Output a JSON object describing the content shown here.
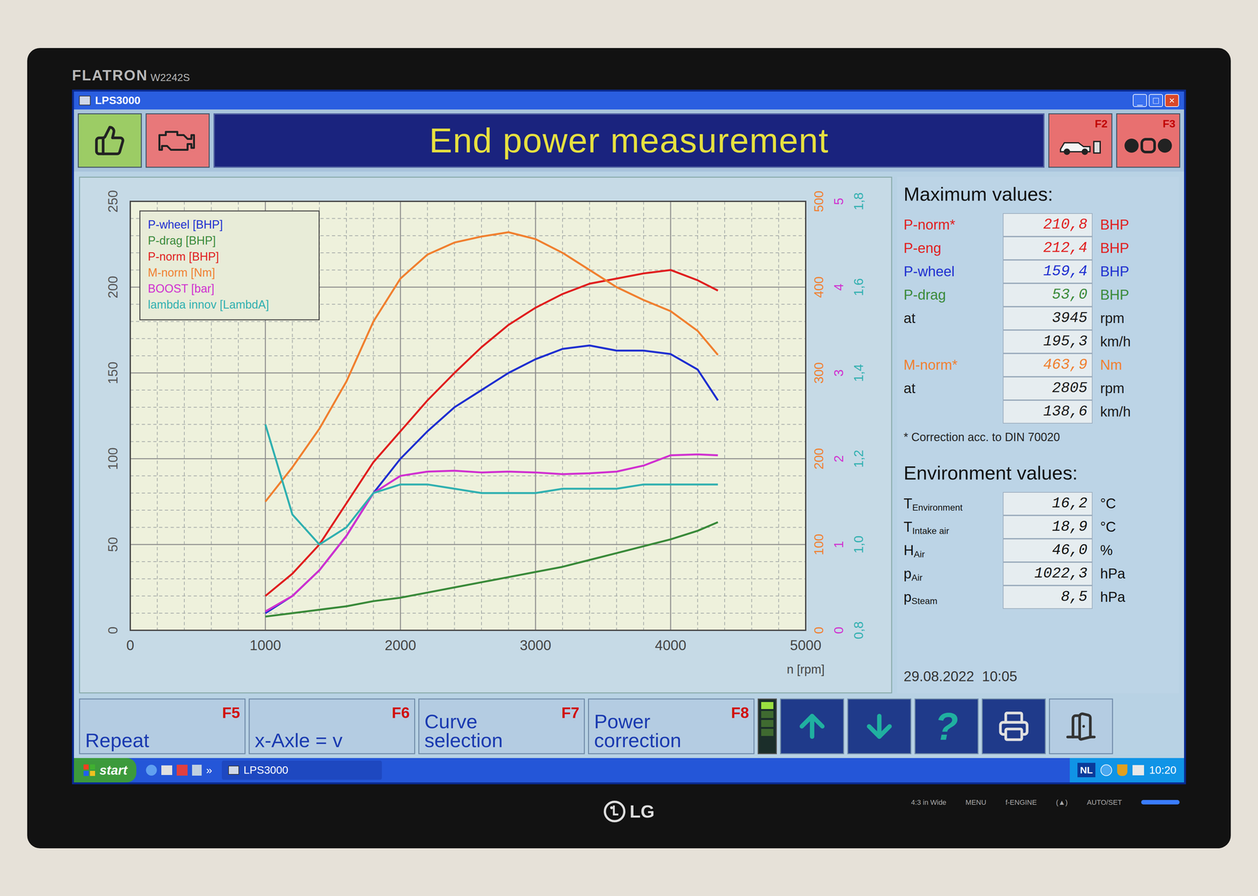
{
  "monitor": {
    "brand": "FLATRON",
    "model": "W2242S",
    "logo": "LG",
    "buttons": [
      "4:3 in Wide",
      "MENU",
      "f-ENGINE",
      "(▲)",
      "AUTO/SET"
    ],
    "power_led": true
  },
  "window": {
    "title": "LPS3000",
    "controls": [
      "_",
      "□",
      "×"
    ]
  },
  "header": {
    "title": "End power measurement",
    "keys": [
      "F2",
      "F3"
    ]
  },
  "chart": {
    "x_ticks": [
      "0",
      "1000",
      "2000",
      "3000",
      "4000",
      "5000"
    ],
    "x_label": "n [rpm]",
    "axes": [
      {
        "name": "power",
        "side": "left",
        "color": "#555555",
        "ticks": [
          "0",
          "50",
          "100",
          "150",
          "200",
          "250"
        ]
      },
      {
        "name": "torque",
        "side": "right",
        "color": "#f08030",
        "ticks": [
          "0",
          "100",
          "200",
          "300",
          "400",
          "500"
        ]
      },
      {
        "name": "boost",
        "side": "right",
        "color": "#d030d0",
        "ticks": [
          "0",
          "1",
          "2",
          "3",
          "4",
          "5"
        ]
      },
      {
        "name": "lambda",
        "side": "right",
        "color": "#30b0b0",
        "ticks": [
          "0,8",
          "1,0",
          "1,2",
          "1,4",
          "1,6",
          "1,8"
        ]
      }
    ],
    "rpm": [
      1000,
      1200,
      1400,
      1600,
      1800,
      2000,
      2200,
      2400,
      2600,
      2800,
      3000,
      3200,
      3400,
      3600,
      3800,
      4000,
      4200,
      4350
    ],
    "series": [
      {
        "label": "P-wheel [BHP]",
        "color": "#2030d0",
        "axis": "power",
        "values": [
          10,
          20,
          35,
          55,
          80,
          100,
          116,
          130,
          140,
          150,
          158,
          164,
          166,
          163,
          163,
          161,
          152,
          134
        ]
      },
      {
        "label": "P-drag [BHP]",
        "color": "#3a8a3a",
        "axis": "power",
        "values": [
          8,
          10,
          12,
          14,
          17,
          19,
          22,
          25,
          28,
          31,
          34,
          37,
          41,
          45,
          49,
          53,
          58,
          63
        ]
      },
      {
        "label": "P-norm [BHP]",
        "color": "#e02020",
        "axis": "power",
        "values": [
          20,
          33,
          50,
          74,
          98,
          116,
          134,
          150,
          165,
          178,
          188,
          196,
          202,
          205,
          208,
          210,
          204,
          198
        ]
      },
      {
        "label": "M-norm [Nm]",
        "color": "#f08030",
        "axis": "torque",
        "values": [
          150,
          190,
          235,
          290,
          360,
          410,
          438,
          452,
          459,
          464,
          456,
          440,
          420,
          400,
          385,
          372,
          349,
          321
        ]
      },
      {
        "label": "BOOST [bar]",
        "color": "#d030d0",
        "axis": "boost",
        "values": [
          0.22,
          0.4,
          0.7,
          1.1,
          1.6,
          1.8,
          1.85,
          1.86,
          1.84,
          1.85,
          1.84,
          1.82,
          1.83,
          1.85,
          1.92,
          2.04,
          2.05,
          2.04
        ]
      },
      {
        "label": "lambda innov [LambdA]",
        "color": "#30b0b0",
        "axis": "lambda",
        "values": [
          1.28,
          1.07,
          1.0,
          1.04,
          1.12,
          1.14,
          1.14,
          1.13,
          1.12,
          1.12,
          1.12,
          1.13,
          1.13,
          1.13,
          1.14,
          1.14,
          1.14,
          1.14
        ]
      }
    ]
  },
  "maximum": {
    "title": "Maximum values:",
    "rows": [
      {
        "label": "P-norm*",
        "value": "210,8",
        "unit": "BHP",
        "color": "#e02020"
      },
      {
        "label": "P-eng",
        "value": "212,4",
        "unit": "BHP",
        "color": "#e02020"
      },
      {
        "label": "P-wheel",
        "value": "159,4",
        "unit": "BHP",
        "color": "#2030d0"
      },
      {
        "label": "P-drag",
        "value": "53,0",
        "unit": "BHP",
        "color": "#3a8a3a"
      },
      {
        "label": "at",
        "value": "3945",
        "unit": "rpm",
        "color": "#1a1a1a"
      },
      {
        "label": "",
        "value": "195,3",
        "unit": "km/h",
        "color": "#1a1a1a"
      },
      {
        "label": "M-norm*",
        "value": "463,9",
        "unit": "Nm",
        "color": "#f08030"
      },
      {
        "label": "at",
        "value": "2805",
        "unit": "rpm",
        "color": "#1a1a1a"
      },
      {
        "label": "",
        "value": "138,6",
        "unit": "km/h",
        "color": "#1a1a1a"
      }
    ],
    "note": "* Correction acc. to DIN 70020"
  },
  "environment": {
    "title": "Environment values:",
    "rows": [
      {
        "label": "T",
        "sub": "Environment",
        "value": "16,2",
        "unit": "°C"
      },
      {
        "label": "T",
        "sub": "Intake air",
        "value": "18,9",
        "unit": "°C"
      },
      {
        "label": "H",
        "sub": "Air",
        "value": "46,0",
        "unit": "%"
      },
      {
        "label": "p",
        "sub": "Air",
        "value": "1022,3",
        "unit": "hPa"
      },
      {
        "label": "p",
        "sub": "Steam",
        "value": "8,5",
        "unit": "hPa"
      }
    ],
    "datetime": "29.08.2022  10:05"
  },
  "function_keys": [
    {
      "label": "Repeat",
      "key": "F5"
    },
    {
      "label": "x-Axle = v",
      "key": "F6"
    },
    {
      "label": "Curve selection",
      "key": "F7"
    },
    {
      "label": "Power correction",
      "key": "F8"
    }
  ],
  "help_glyph": "?",
  "taskbar": {
    "start": "start",
    "more": "»",
    "task": "LPS3000",
    "language": "NL",
    "clock": "10:20"
  }
}
